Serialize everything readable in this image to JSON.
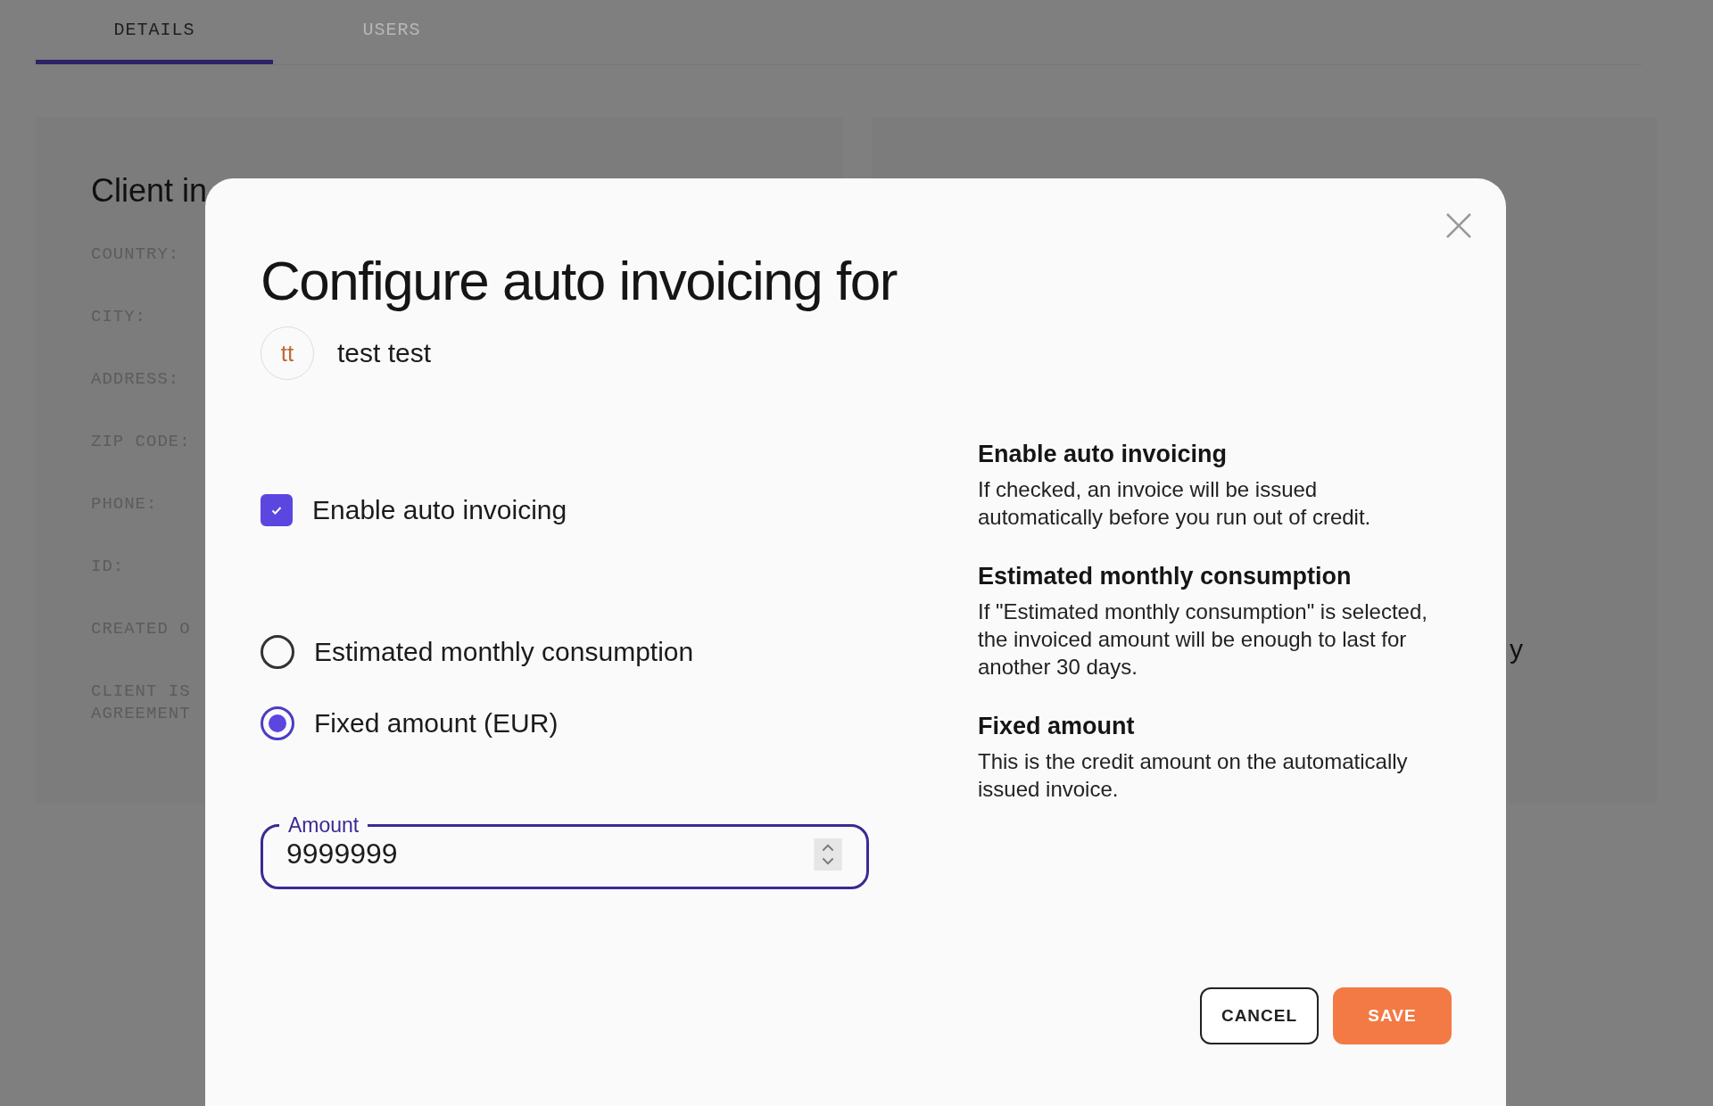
{
  "tabs": [
    {
      "label": "DETAILS",
      "selected": true
    },
    {
      "label": "USERS",
      "selected": false
    }
  ],
  "client_card": {
    "title": "Client in",
    "fields": [
      "COUNTRY:",
      "CITY:",
      "ADDRESS:",
      "ZIP CODE:",
      "PHONE:",
      "ID:",
      "CREATED O",
      "CLIENT IS\nAGREEMENT"
    ]
  },
  "right_card": {
    "text": "y"
  },
  "modal": {
    "title": "Configure auto invoicing for",
    "client": {
      "initials": "tt",
      "name": "test test"
    },
    "enable": {
      "label": "Enable auto invoicing",
      "checked": true
    },
    "options": [
      {
        "label": "Estimated monthly consumption",
        "selected": false
      },
      {
        "label": "Fixed amount (EUR)",
        "selected": true
      }
    ],
    "amount": {
      "label": "Amount",
      "value": "9999999"
    },
    "help": [
      {
        "heading": "Enable auto invoicing",
        "text": "If checked, an invoice will be issued automatically before you run out of credit."
      },
      {
        "heading": "Estimated monthly consumption",
        "text": "If \"Estimated monthly consumption\" is selected, the invoiced amount will be enough to last for another 30 days."
      },
      {
        "heading": "Fixed amount",
        "text": "This is the credit amount on the automatically issued invoice."
      }
    ],
    "buttons": {
      "cancel": "CANCEL",
      "save": "SAVE"
    }
  }
}
